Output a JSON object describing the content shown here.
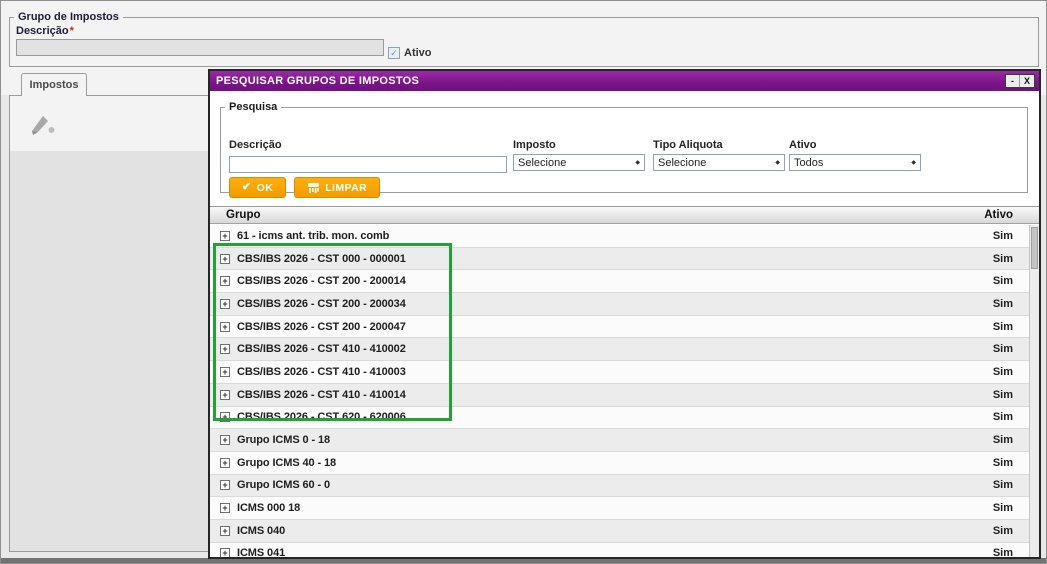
{
  "form": {
    "fieldset_title": "Grupo de Impostos",
    "descricao_label": "Descrição",
    "required_asterisk": "*",
    "descricao_value": "",
    "ativo_label": "Ativo",
    "tab_label": "Impostos"
  },
  "modal": {
    "title": "PESQUISAR GRUPOS DE IMPOSTOS",
    "minimize": "-",
    "close": "X",
    "search": {
      "legend": "Pesquisa",
      "fields": {
        "descricao": {
          "label": "Descrição",
          "value": ""
        },
        "imposto": {
          "label": "Imposto",
          "value": "Selecione"
        },
        "tipo_aliquota": {
          "label": "Tipo Aliquota",
          "value": "Selecione"
        },
        "ativo": {
          "label": "Ativo",
          "value": "Todos"
        }
      },
      "buttons": {
        "ok": "OK",
        "limpar": "LIMPAR"
      }
    },
    "table": {
      "columns": {
        "grupo": "Grupo",
        "ativo": "Ativo"
      },
      "expand_symbol": "+",
      "rows": [
        {
          "grupo": "61 - icms ant. trib. mon. comb",
          "ativo": "Sim"
        },
        {
          "grupo": "CBS/IBS 2026 - CST 000 - 000001",
          "ativo": "Sim"
        },
        {
          "grupo": "CBS/IBS 2026 - CST 200 - 200014",
          "ativo": "Sim"
        },
        {
          "grupo": "CBS/IBS 2026 - CST 200 - 200034",
          "ativo": "Sim"
        },
        {
          "grupo": "CBS/IBS 2026 - CST 200 - 200047",
          "ativo": "Sim"
        },
        {
          "grupo": "CBS/IBS 2026 - CST 410 - 410002",
          "ativo": "Sim"
        },
        {
          "grupo": "CBS/IBS 2026 - CST 410 - 410003",
          "ativo": "Sim"
        },
        {
          "grupo": "CBS/IBS 2026 - CST 410 - 410014",
          "ativo": "Sim"
        },
        {
          "grupo": "CBS/IBS 2026 - CST 620 - 620006",
          "ativo": "Sim"
        },
        {
          "grupo": "Grupo ICMS 0 - 18",
          "ativo": "Sim"
        },
        {
          "grupo": "Grupo ICMS 40 - 18",
          "ativo": "Sim"
        },
        {
          "grupo": "Grupo ICMS 60 - 0",
          "ativo": "Sim"
        },
        {
          "grupo": "ICMS 000 18",
          "ativo": "Sim"
        },
        {
          "grupo": "ICMS 040",
          "ativo": "Sim"
        },
        {
          "grupo": "ICMS 041",
          "ativo": "Sim"
        }
      ]
    }
  },
  "colors": {
    "title_bar": "#7a1487",
    "title_top": "#9a2ba6",
    "button_orange": "#f39c00",
    "highlight_green": "#1fa332"
  }
}
